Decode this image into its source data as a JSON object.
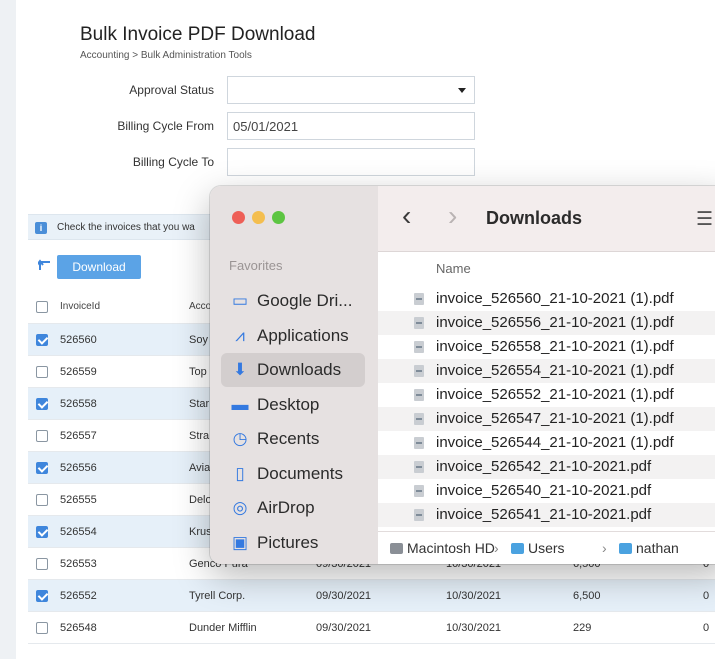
{
  "page": {
    "title": "Bulk Invoice PDF Download",
    "breadcrumb": "Accounting > Bulk Administration Tools"
  },
  "form": {
    "approval_status_label": "Approval Status",
    "approval_status_value": "",
    "billing_from_label": "Billing Cycle From",
    "billing_from_value": "05/01/2021",
    "billing_to_label": "Billing Cycle To",
    "billing_to_value": ""
  },
  "info": {
    "text": "Check the invoices that you wa"
  },
  "toolbar": {
    "download_label": "Download"
  },
  "table": {
    "headers": [
      "InvoiceId",
      "Acco"
    ],
    "rows": [
      {
        "id": "526560",
        "account": "Soy",
        "from": "",
        "to": "",
        "amount": "",
        "balance": "",
        "checked": true
      },
      {
        "id": "526559",
        "account": "Top",
        "from": "",
        "to": "",
        "amount": "",
        "balance": "",
        "checked": false
      },
      {
        "id": "526558",
        "account": "Star",
        "from": "",
        "to": "",
        "amount": "",
        "balance": "",
        "checked": true
      },
      {
        "id": "526557",
        "account": "Stra",
        "from": "",
        "to": "",
        "amount": "",
        "balance": "",
        "checked": false
      },
      {
        "id": "526556",
        "account": "Avia",
        "from": "",
        "to": "",
        "amount": "",
        "balance": "",
        "checked": true
      },
      {
        "id": "526555",
        "account": "Delo",
        "from": "",
        "to": "",
        "amount": "",
        "balance": "",
        "checked": false
      },
      {
        "id": "526554",
        "account": "Krus",
        "from": "",
        "to": "",
        "amount": "",
        "balance": "",
        "checked": true
      },
      {
        "id": "526553",
        "account": "Genco Pura",
        "from": "09/30/2021",
        "to": "10/30/2021",
        "amount": "6,500",
        "balance": "0",
        "checked": false
      },
      {
        "id": "526552",
        "account": "Tyrell Corp.",
        "from": "09/30/2021",
        "to": "10/30/2021",
        "amount": "6,500",
        "balance": "0",
        "checked": true
      },
      {
        "id": "526548",
        "account": "Dunder Mifflin",
        "from": "09/30/2021",
        "to": "10/30/2021",
        "amount": "229",
        "balance": "0",
        "checked": false
      }
    ]
  },
  "finder": {
    "favorites_heading": "Favorites",
    "sidebar": [
      {
        "label": "Google Dri...",
        "icon": "folder-icon",
        "glyph": "▭"
      },
      {
        "label": "Applications",
        "icon": "applications-icon",
        "glyph": "⩘"
      },
      {
        "label": "Downloads",
        "icon": "downloads-icon",
        "glyph": "⬇"
      },
      {
        "label": "Desktop",
        "icon": "desktop-icon",
        "glyph": "▬"
      },
      {
        "label": "Recents",
        "icon": "recents-icon",
        "glyph": "◷"
      },
      {
        "label": "Documents",
        "icon": "documents-icon",
        "glyph": "▯"
      },
      {
        "label": "AirDrop",
        "icon": "airdrop-icon",
        "glyph": "◎"
      },
      {
        "label": "Pictures",
        "icon": "pictures-icon",
        "glyph": "▣"
      }
    ],
    "active_item": "Downloads",
    "back_glyph": "‹",
    "forward_glyph": "›",
    "view_glyph": "☰",
    "folder_title": "Downloads",
    "column_name": "Name",
    "files": [
      "invoice_526560_21-10-2021 (1).pdf",
      "invoice_526556_21-10-2021 (1).pdf",
      "invoice_526558_21-10-2021 (1).pdf",
      "invoice_526554_21-10-2021 (1).pdf",
      "invoice_526552_21-10-2021 (1).pdf",
      "invoice_526547_21-10-2021 (1).pdf",
      "invoice_526544_21-10-2021 (1).pdf",
      "invoice_526542_21-10-2021.pdf",
      "invoice_526540_21-10-2021.pdf",
      "invoice_526541_21-10-2021.pdf"
    ],
    "path": [
      "Macintosh HD",
      "Users",
      "nathan",
      ""
    ],
    "path_separator": "›"
  },
  "colors": {
    "accent": "#3f86dc",
    "download_button": "#5ba3e6",
    "selected_row": "#e6f0f9",
    "traffic_red": "#ee5f57",
    "traffic_yellow": "#f4be4f",
    "traffic_green": "#5dc542"
  }
}
